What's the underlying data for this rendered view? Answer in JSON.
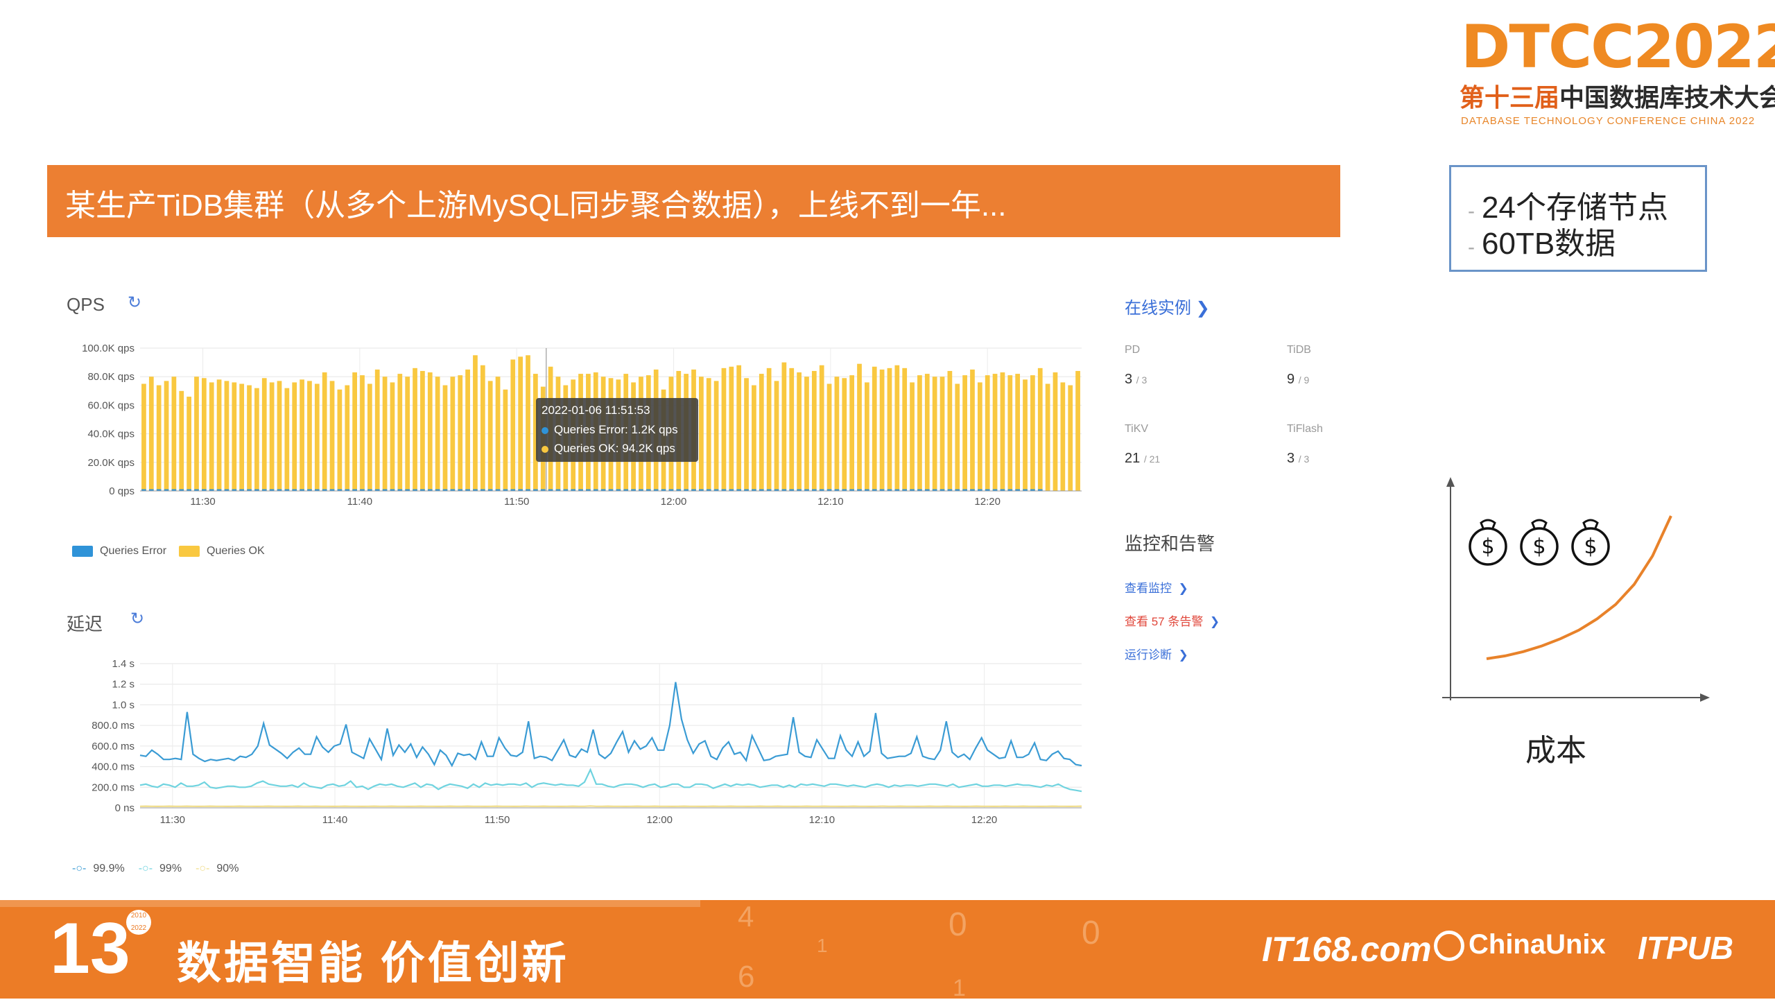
{
  "logo": {
    "main": "DTCC2022",
    "sub_prefix": "第十三届",
    "sub_main": "中国数据库技术大会",
    "english": "DATABASE TECHNOLOGY CONFERENCE CHINA 2022"
  },
  "banner": {
    "title": "某生产TiDB集群（从多个上游MySQL同步聚合数据），上线不到一年..."
  },
  "infobox": {
    "lines": [
      "24个存储节点",
      "60TB数据"
    ]
  },
  "qps_panel": {
    "title": "QPS",
    "refresh_icon": "refresh-icon",
    "legend": [
      "Queries Error",
      "Queries OK"
    ],
    "colors": {
      "error": "#2f93d8",
      "ok": "#f9c840"
    },
    "tooltip": {
      "time": "2022-01-06 11:51:53",
      "error": "Queries Error: 1.2K qps",
      "ok": "Queries OK: 94.2K qps"
    }
  },
  "latency_panel": {
    "title": "延迟",
    "refresh_icon": "refresh-icon",
    "legend": [
      "99.9%",
      "99%",
      "90%"
    ],
    "colors": {
      "p999": "#3a9bd4",
      "p99": "#6fd3df",
      "p90": "#f0dd8a"
    }
  },
  "chart_data": [
    {
      "type": "bar",
      "title": "QPS",
      "y_ticks": [
        "100.0K qps",
        "80.0K qps",
        "60.0K qps",
        "40.0K qps",
        "20.0K qps",
        "0 qps"
      ],
      "ylim": [
        0,
        100
      ],
      "x_ticks": [
        "11:30",
        "11:40",
        "11:50",
        "12:00",
        "12:10",
        "12:20"
      ],
      "x_tick_minutes": [
        4,
        14,
        24,
        34,
        44,
        54
      ],
      "x_range_minutes": [
        0,
        60
      ],
      "series": [
        {
          "name": "Queries Error",
          "unit": "K qps",
          "values": [
            1.2,
            1.2,
            1.2,
            1.2,
            1.2,
            1.2,
            1.2,
            1.2,
            1.2,
            1.2,
            1.2,
            1.2,
            1.2,
            1.2,
            1.2,
            1.2,
            1.2,
            1.2,
            1.2,
            1.2,
            1.2,
            1.2,
            1.2,
            1.2,
            1.2,
            1.2,
            1.2,
            1.2,
            1.2,
            1.2,
            1.2,
            1.2,
            1.2,
            1.2,
            1.2,
            1.2,
            1.2,
            1.2,
            1.2,
            1.2,
            1.2,
            1.2,
            1.2,
            1.2,
            1.2,
            1.2,
            1.2,
            1.2,
            1.2,
            1.2,
            1.2,
            1.2,
            1.2,
            1.2,
            1.2,
            1.2,
            1.2,
            1.2,
            1.2,
            1.2,
            1.2,
            1.2,
            1.2,
            1.2,
            1.2,
            1.2,
            1.2,
            1.2,
            1.2,
            1.2,
            1.2,
            1.2,
            1.2,
            1.2,
            1.2,
            1.2,
            1.2,
            1.2,
            1.2,
            1.2,
            1.2,
            1.2,
            1.2,
            1.2,
            1.2,
            1.2,
            1.2,
            1.2,
            1.2,
            1.2,
            1.2,
            1.2,
            1.2,
            1.2,
            1.2,
            1.2,
            1.2,
            1.2,
            1.2,
            1.2,
            1.2,
            1.2,
            1.2,
            1.2,
            1.2,
            1.2,
            1.2,
            1.2,
            1.2,
            1.2,
            1.2,
            1.2,
            1.2,
            1.2,
            1.2,
            1.2,
            1.2,
            1.2,
            1.2,
            1.2
          ]
        },
        {
          "name": "Queries OK",
          "unit": "K qps",
          "values": [
            75,
            80,
            74,
            77,
            80,
            70,
            66,
            80,
            79,
            76,
            78,
            77,
            76,
            75,
            74,
            72,
            79,
            76,
            77,
            72,
            76,
            78,
            77,
            75,
            83,
            77,
            71,
            74,
            83,
            81,
            75,
            85,
            80,
            76,
            82,
            80,
            86,
            84,
            83,
            80,
            74,
            80,
            81,
            85,
            95,
            88,
            77,
            80,
            71,
            92,
            94,
            95,
            82,
            73,
            87,
            80,
            74,
            78,
            82,
            82,
            83,
            80,
            79,
            78,
            82,
            76,
            80,
            81,
            85,
            71,
            80,
            84,
            82,
            85,
            80,
            79,
            77,
            86,
            87,
            88,
            79,
            74,
            82,
            86,
            77,
            90,
            86,
            83,
            80,
            84,
            88,
            75,
            80,
            79,
            81,
            89,
            76,
            87,
            85,
            86,
            88,
            86,
            76,
            81,
            82,
            80,
            80,
            84,
            75,
            81,
            85,
            76,
            81,
            82,
            83,
            81,
            82,
            78,
            81,
            86,
            75,
            83,
            76,
            74,
            84
          ]
        }
      ]
    },
    {
      "type": "line",
      "title": "延迟",
      "y_ticks": [
        "1.4 s",
        "1.2 s",
        "1.0 s",
        "800.0 ms",
        "600.0 ms",
        "400.0 ms",
        "200.0 ms",
        "0 ns"
      ],
      "ylim": [
        0,
        1400
      ],
      "x_ticks": [
        "11:30",
        "11:40",
        "11:50",
        "12:00",
        "12:10",
        "12:20"
      ],
      "x_tick_minutes": [
        2,
        12,
        22,
        32,
        42,
        52
      ],
      "x_range_minutes": [
        0,
        58
      ],
      "series": [
        {
          "name": "99.9%",
          "unit": "ms",
          "values": [
            510,
            500,
            560,
            520,
            470,
            470,
            480,
            470,
            930,
            520,
            480,
            450,
            470,
            460,
            470,
            480,
            460,
            500,
            490,
            520,
            600,
            820,
            610,
            570,
            530,
            480,
            540,
            580,
            520,
            520,
            690,
            590,
            540,
            600,
            620,
            810,
            540,
            510,
            480,
            670,
            570,
            470,
            770,
            510,
            610,
            540,
            620,
            490,
            590,
            520,
            420,
            560,
            510,
            410,
            530,
            510,
            520,
            470,
            640,
            500,
            500,
            680,
            580,
            510,
            500,
            540,
            840,
            480,
            500,
            490,
            460,
            560,
            660,
            510,
            490,
            570,
            540,
            760,
            520,
            480,
            530,
            640,
            740,
            540,
            650,
            570,
            600,
            680,
            560,
            560,
            800,
            1220,
            860,
            660,
            530,
            620,
            650,
            500,
            470,
            580,
            640,
            520,
            540,
            460,
            700,
            580,
            460,
            470,
            500,
            510,
            520,
            880,
            540,
            500,
            490,
            660,
            570,
            480,
            480,
            700,
            560,
            500,
            640,
            500,
            550,
            920,
            530,
            480,
            490,
            500,
            500,
            530,
            690,
            500,
            480,
            470,
            560,
            840,
            540,
            490,
            520,
            470,
            580,
            680,
            560,
            520,
            480,
            490,
            650,
            490,
            490,
            520,
            630,
            470,
            460,
            520,
            550,
            480,
            470,
            420,
            410
          ]
        },
        {
          "name": "99%",
          "unit": "ms",
          "values": [
            220,
            230,
            210,
            200,
            230,
            220,
            200,
            240,
            210,
            210,
            220,
            250,
            200,
            190,
            200,
            210,
            210,
            200,
            200,
            210,
            240,
            260,
            230,
            220,
            210,
            210,
            220,
            200,
            240,
            210,
            200,
            190,
            220,
            230,
            210,
            220,
            260,
            200,
            210,
            180,
            210,
            230,
            220,
            230,
            210,
            200,
            220,
            240,
            200,
            230,
            220,
            180,
            210,
            230,
            220,
            210,
            190,
            230,
            200,
            240,
            220,
            230,
            220,
            230,
            230,
            220,
            240,
            200,
            230,
            240,
            230,
            220,
            230,
            220,
            220,
            210,
            250,
            370,
            230,
            230,
            210,
            200,
            220,
            230,
            230,
            220,
            200,
            220,
            230,
            200,
            210,
            230,
            230,
            200,
            200,
            230,
            230,
            220,
            190,
            210,
            230,
            210,
            230,
            220,
            230,
            220,
            200,
            210,
            220,
            220,
            200,
            220,
            200,
            230,
            220,
            230,
            220,
            210,
            230,
            230,
            220,
            210,
            220,
            210,
            200,
            220,
            230,
            220,
            200,
            220,
            210,
            220,
            220,
            210,
            220,
            230,
            230,
            220,
            210,
            230,
            200,
            210,
            220,
            230,
            210,
            210,
            220,
            220,
            210,
            220,
            230,
            220,
            220,
            210,
            200,
            220,
            210,
            230,
            200,
            180,
            170,
            160
          ]
        },
        {
          "name": "90%",
          "unit": "ms",
          "values": [
            15,
            16,
            15,
            14,
            15,
            16,
            15,
            15,
            16,
            15,
            14,
            15,
            16,
            15,
            15,
            14,
            15,
            16,
            15,
            15,
            14,
            15,
            16,
            15,
            15,
            14,
            15,
            16,
            15,
            15,
            16,
            15,
            15,
            14,
            15,
            16,
            15,
            15,
            14,
            15,
            16,
            15,
            15,
            16,
            15,
            15,
            14,
            15,
            16,
            15,
            15,
            14,
            15,
            16,
            15,
            15,
            16,
            15,
            15,
            14,
            15,
            16,
            15,
            15,
            14,
            15,
            16,
            15,
            15,
            16,
            15,
            15,
            14,
            15,
            16,
            15,
            15,
            18,
            15,
            15,
            16,
            15,
            15,
            14,
            15,
            16,
            15,
            15,
            16,
            15,
            15,
            14,
            15,
            16,
            15,
            15,
            14,
            15,
            16,
            15,
            15,
            16,
            15,
            15,
            14,
            15,
            16,
            15,
            15,
            16,
            15,
            15,
            14,
            15,
            16,
            15,
            15,
            16,
            15,
            15,
            14,
            15,
            16,
            15,
            15,
            14,
            15,
            16,
            15,
            15,
            16,
            15,
            15,
            14,
            15,
            16,
            15,
            15,
            16,
            15,
            15,
            14,
            15,
            16,
            15,
            15,
            14,
            15,
            16,
            15,
            15,
            16,
            15,
            15,
            14,
            15,
            16,
            15,
            15,
            14,
            15,
            16
          ]
        }
      ]
    },
    {
      "type": "line",
      "title": "",
      "xlabel": "成本",
      "note": "conceptual rising cost curve with three money-bag icons",
      "x": [
        0,
        1,
        2,
        3,
        4,
        5,
        6,
        7,
        8,
        9,
        10
      ],
      "values": [
        0,
        2,
        5,
        9,
        14,
        20,
        28,
        38,
        52,
        72,
        100
      ]
    }
  ],
  "right_panel": {
    "instances_link": "在线实例",
    "stats": [
      {
        "label": "PD",
        "value": "3",
        "total": "/ 3"
      },
      {
        "label": "TiDB",
        "value": "9",
        "total": "/ 9"
      },
      {
        "label": "TiKV",
        "value": "21",
        "total": "/ 21"
      },
      {
        "label": "TiFlash",
        "value": "3",
        "total": "/ 3"
      }
    ],
    "monitor_title": "监控和告警",
    "links": [
      {
        "text": "查看监控",
        "color": "#3a6fd8"
      },
      {
        "text": "查看 57 条告警",
        "color": "#e0463a"
      },
      {
        "text": "运行诊断",
        "color": "#3a6fd8"
      }
    ]
  },
  "cost_chart": {
    "xlabel": "成本",
    "icons": [
      "money-bag-icon",
      "money-bag-icon",
      "money-bag-icon"
    ],
    "curve_color": "#e8822a"
  },
  "footer": {
    "number": "13",
    "badge_top": "2010",
    "badge_bottom": "2022",
    "slogan": "数据智能  价值创新",
    "logos": [
      "IT168.com",
      "ChinaUnix",
      "ITPUB"
    ],
    "decor_digits": [
      "4",
      "0",
      "1",
      "0",
      "6",
      "1",
      "1",
      "0",
      "0",
      "1"
    ]
  }
}
